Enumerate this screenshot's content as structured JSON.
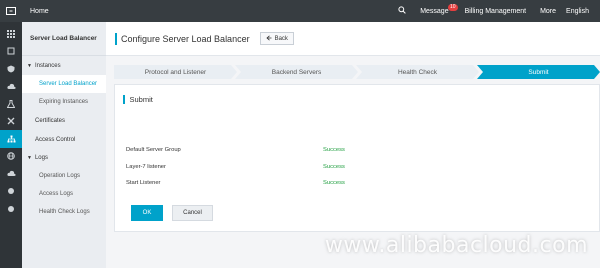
{
  "topbar": {
    "home": "Home",
    "message": "Message",
    "message_badge": "10",
    "billing": "Billing Management",
    "more": "More",
    "language": "English"
  },
  "rail": {
    "icons": [
      "grid-icon",
      "box-icon",
      "shield-icon",
      "cloud-icon",
      "flask-icon",
      "tools-icon",
      "network-icon",
      "globe-icon",
      "cloud-icon",
      "circle-icon",
      "circle-icon"
    ]
  },
  "sidebar": {
    "title": "Server Load Balancer",
    "instances_group": "Instances",
    "server_load_balancer": "Server Load Balancer",
    "expiring_instances": "Expiring Instances",
    "certificates": "Certificates",
    "access_control": "Access Control",
    "logs_group": "Logs",
    "operation_logs": "Operation Logs",
    "access_logs": "Access Logs",
    "health_check_logs": "Health Check Logs"
  },
  "header": {
    "title": "Configure Server Load Balancer",
    "back": "Back"
  },
  "steps": [
    "Protocol and Listener",
    "Backend Servers",
    "Health Check",
    "Submit"
  ],
  "panel": {
    "title": "Submit",
    "rows": [
      {
        "label": "Default Server Group",
        "status": "Success"
      },
      {
        "label": "Layer-7 listener",
        "status": "Success"
      },
      {
        "label": "Start Listener",
        "status": "Success"
      }
    ],
    "ok": "OK",
    "cancel": "Cancel"
  },
  "watermark": "www.alibabacloud.com",
  "colors": {
    "accent": "#00a2ca",
    "success": "#1e9e3e",
    "topbar": "#373d41"
  }
}
